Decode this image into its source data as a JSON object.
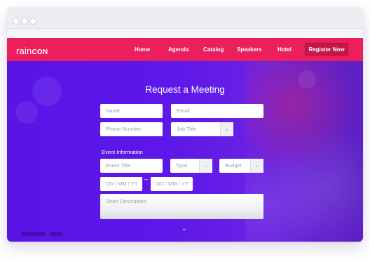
{
  "brand": {
    "logo_main": "rain",
    "logo_sub": "CON"
  },
  "nav": {
    "items": [
      "Home",
      "Agenda",
      "Catalog",
      "Speakers",
      "Hotel"
    ],
    "cta": "Register Now"
  },
  "form": {
    "title": "Request a Meeting",
    "name_placeholder": "Name",
    "email_placeholder": "Email",
    "phone_placeholder": "Phone Number",
    "job_title_placeholder": "Job Title",
    "section_label": "Event Information",
    "event_title_placeholder": "Event Title",
    "type_placeholder": "Type",
    "budget_placeholder": "Budget",
    "date_start_placeholder": "DD / MM / YY",
    "date_separator": "–",
    "date_end_placeholder": "DD / MM / YY",
    "description_placeholder": "Short Description"
  },
  "icons": {
    "select_arrow": "chevron-down-icon",
    "scroll": "chevron-down-icon"
  },
  "colors": {
    "accent": "#ec1f5d",
    "background": "#5a14e6",
    "cta": "#c8154b"
  }
}
